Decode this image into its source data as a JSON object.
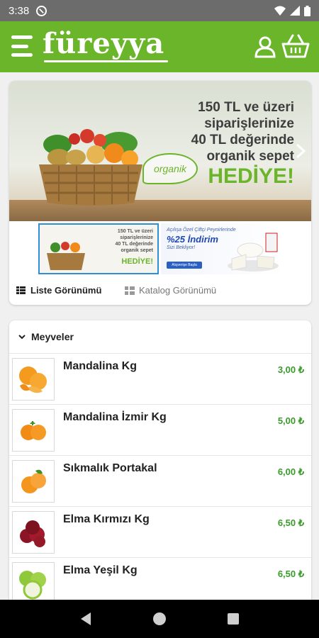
{
  "status_bar": {
    "time": "3:38"
  },
  "app_bar": {
    "logo": "füreyya"
  },
  "banner": {
    "line1": "150 TL ve üzeri",
    "line2": "siparişlerinize",
    "line3": "40 TL değerinde",
    "line4": "organik sepet",
    "highlight": "HEDİYE!",
    "badge": "organik"
  },
  "thumb1": {
    "line1": "150 TL ve üzeri",
    "line2": "siparişlerinize",
    "line3": "40 TL değerinde",
    "line4": "organik sepet",
    "highlight": "HEDİYE!"
  },
  "thumb2": {
    "line1": "Açılışa Özel Çiftçi Peynirlerinde",
    "line2": "%25 İndirim",
    "line3": "Sizi Bekliyor!",
    "button": "Alışverişe Başla"
  },
  "view": {
    "list_label": "Liste Görünümü",
    "catalog_label": "Katalog Görünümü"
  },
  "category": {
    "title": "Meyveler"
  },
  "products": [
    {
      "name": "Mandalina Kg",
      "price": "3,00 ₺"
    },
    {
      "name": "Mandalina İzmir Kg",
      "price": "5,00 ₺"
    },
    {
      "name": "Sıkmalık Portakal",
      "price": "6,00 ₺"
    },
    {
      "name": "Elma Kırmızı Kg",
      "price": "6,50 ₺"
    },
    {
      "name": "Elma Yeşil Kg",
      "price": "6,50 ₺"
    }
  ],
  "colors": {
    "brand": "#6bb52b",
    "price": "#3a9a2a",
    "status": "#6c6c6c"
  },
  "icons": [
    "menu-icon",
    "user-icon",
    "basket-icon",
    "chevron-down-icon",
    "list-view-icon",
    "grid-view-icon",
    "back-icon",
    "home-icon",
    "recents-icon"
  ]
}
